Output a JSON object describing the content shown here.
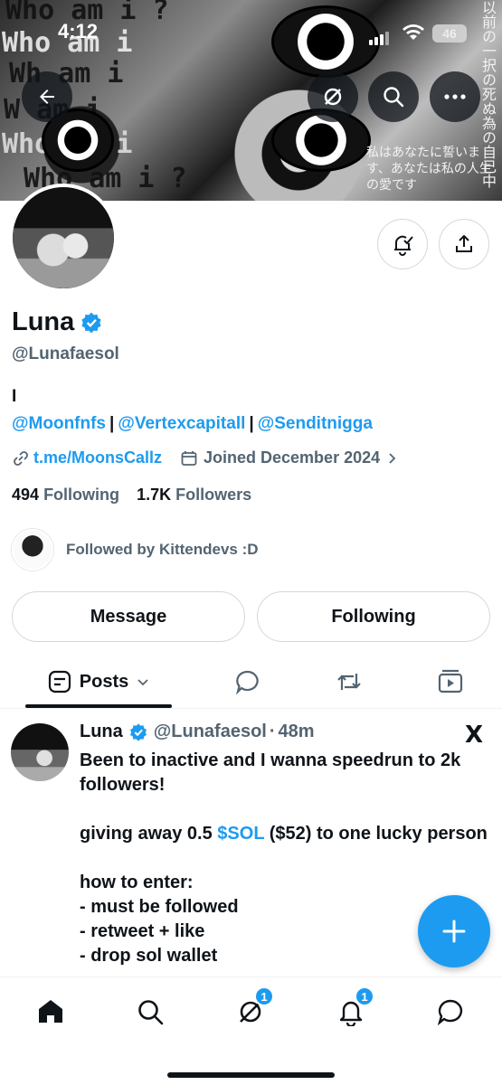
{
  "status_bar": {
    "time": "4:12",
    "battery": "46"
  },
  "banner": {
    "lines": [
      "Who am i ?",
      "Who am i",
      "Wh am i",
      "W  am i",
      "Who am i",
      "Who am i ?"
    ],
    "jp_right": "以前の一択の死ぬ為の自己中",
    "jp_bottom": "私はあなたに誓います、あなたは私の人生の愛です"
  },
  "profile": {
    "name": "Luna",
    "handle": "@Lunafaesol",
    "bio": "I",
    "mentions": [
      "@Moonfnfs",
      "@Vertexcapitall",
      "@Senditnigga"
    ],
    "mention_sep": "|",
    "url": "t.me/MoonsCallz",
    "joined": "Joined December 2024",
    "following_count": "494",
    "following_label": "Following",
    "followers_count": "1.7K",
    "followers_label": "Followers",
    "followed_by": "Followed by Kittendevs :D"
  },
  "actions": {
    "message": "Message",
    "following": "Following"
  },
  "tabs": {
    "posts": "Posts"
  },
  "post": {
    "name": "Luna",
    "handle": "@Lunafaesol",
    "dot": "·",
    "time": "48m",
    "x_logo": "X",
    "line1": "Been to inactive and I wanna speedrun to 2k followers!",
    "line2a": "giving away 0.5 ",
    "cashtag": "$SOL",
    "line2b": " ($52) to one lucky person",
    "line3": "how to enter:\n- must be followed\n- retweet + like\n- drop sol wallet"
  },
  "bottom_nav": {
    "grok_badge": "1",
    "notif_badge": "1"
  },
  "colors": {
    "accent": "#1d9bf0",
    "text": "#0f1419",
    "muted": "#536471"
  }
}
